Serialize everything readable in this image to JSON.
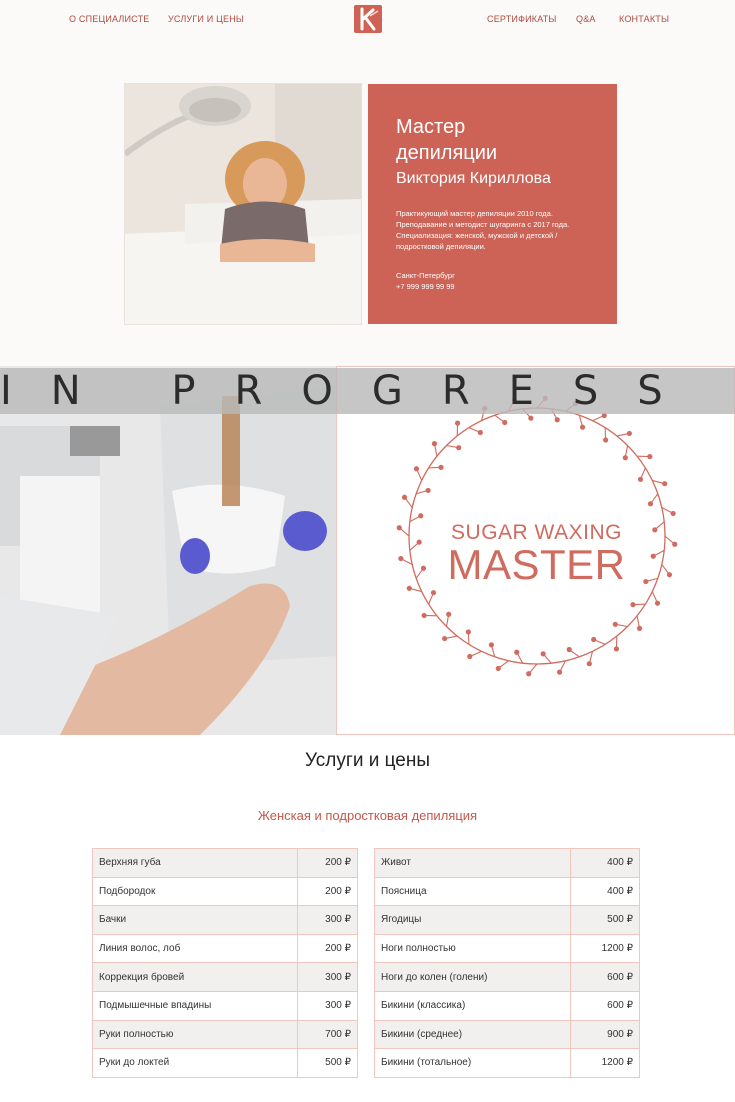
{
  "nav": {
    "left_items": [
      "О СПЕЦИАЛИСТЕ",
      "УСЛУГИ И ЦЕНЫ"
    ],
    "right_items": [
      "СЕРТИФИКАТЫ",
      "Q&A",
      "КОНТАКТЫ"
    ],
    "logo_icon": "logo-k-icon"
  },
  "hero": {
    "title_line1": "Мастер",
    "title_line2": "депиляции",
    "name": "Виктория Кириллова",
    "description": "Практикующий мастер депиляции 2010 года. Преподавание и методист шугаринга с 2017 года. Специализация: женской, мужской и детской / подростковой депиляции.",
    "city": "Санкт-Петербург",
    "phone": "+7 999 999 99 99",
    "card_color": "#cd6356"
  },
  "banner": {
    "progress_text": "IN PROGRESS",
    "sugar_line1": "SUGAR WAXING",
    "sugar_line2": "MASTER",
    "accent_color": "#d06b5f"
  },
  "services": {
    "title": "Услуги и цены",
    "subtitle": "Женская и подростковая депиляция",
    "left": [
      {
        "name": "Верхняя губа",
        "price": "200 ₽"
      },
      {
        "name": "Подбородок",
        "price": "200 ₽"
      },
      {
        "name": "Бачки",
        "price": "300 ₽"
      },
      {
        "name": "Линия волос, лоб",
        "price": "200 ₽"
      },
      {
        "name": "Коррекция бровей",
        "price": "300 ₽"
      },
      {
        "name": "Подмышечные впадины",
        "price": "300 ₽"
      },
      {
        "name": "Руки полностью",
        "price": "700 ₽"
      },
      {
        "name": "Руки до локтей",
        "price": "500 ₽"
      }
    ],
    "right": [
      {
        "name": "Живот",
        "price": "400 ₽"
      },
      {
        "name": "Поясница",
        "price": "400 ₽"
      },
      {
        "name": "Ягодицы",
        "price": "500 ₽"
      },
      {
        "name": "Ноги полностью",
        "price": "1200 ₽"
      },
      {
        "name": "Ноги до колен (голени)",
        "price": "600 ₽"
      },
      {
        "name": "Бикини (классика)",
        "price": "600 ₽"
      },
      {
        "name": "Бикини (среднее)",
        "price": "900 ₽"
      },
      {
        "name": "Бикини (тотальное)",
        "price": "1200 ₽"
      }
    ]
  }
}
